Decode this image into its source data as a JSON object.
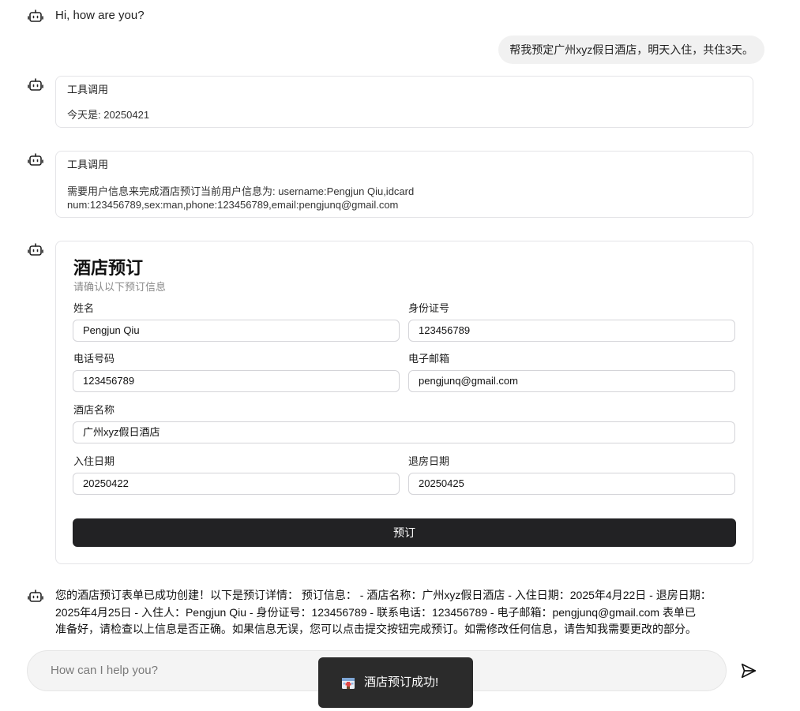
{
  "messages": {
    "greeting": "Hi, how are you?",
    "user_request": "帮我预定广州xyz假日酒店，明天入住，共住3天。",
    "tool_call_1": {
      "title": "工具调用",
      "body": "今天是: 20250421"
    },
    "tool_call_2": {
      "title": "工具调用",
      "body_line1": "需要用户信息来完成酒店预订当前用户信息为: username:Pengjun Qiu,idcard",
      "body_line2": "num:123456789,sex:man,phone:123456789,email:pengjunq@gmail.com"
    },
    "summary_line1": "您的酒店预订表单已成功创建！以下是预订详情： 预订信息： - 酒店名称：广州xyz假日酒店 - 入住日期：2025年4月22日 - 退房日期：",
    "summary_line2": "2025年4月25日 - 入住人：Pengjun Qiu - 身份证号：123456789 - 联系电话：123456789 - 电子邮箱：pengjunq@gmail.com 表单已",
    "summary_line3": "准备好，请检查以上信息是否正确。如果信息无误，您可以点击提交按钮完成预订。如需修改任何信息，请告知我需要更改的部分。"
  },
  "form": {
    "title": "酒店预订",
    "subtitle": "请确认以下预订信息",
    "name_label": "姓名",
    "name_value": "Pengjun Qiu",
    "id_label": "身份证号",
    "id_value": "123456789",
    "phone_label": "电话号码",
    "phone_value": "123456789",
    "email_label": "电子邮箱",
    "email_value": "pengjunq@gmail.com",
    "hotel_label": "酒店名称",
    "hotel_value": "广州xyz假日酒店",
    "checkin_label": "入住日期",
    "checkin_value": "20250422",
    "checkout_label": "退房日期",
    "checkout_value": "20250425",
    "submit_label": "预订"
  },
  "chat_input": {
    "placeholder": "How can I help you?"
  },
  "toast": {
    "icon": "hotel-icon",
    "text": "酒店预订成功!"
  },
  "icons": {
    "assistant": "robot-icon",
    "send": "send-icon"
  },
  "colors": {
    "button_bg": "#222224",
    "toast_bg": "#2b2b2b",
    "input_bg": "#f4f4f4",
    "user_bubble_bg": "#f1f1f1"
  }
}
